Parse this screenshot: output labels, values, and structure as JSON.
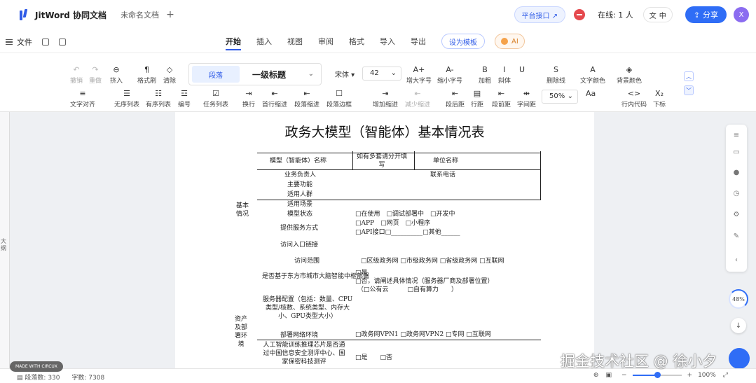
{
  "topbar": {
    "app_title": "JitWord 协同文档",
    "doc_tab": "未命名文档",
    "new_tab": "+",
    "platform_btn": "平台接口 ↗",
    "online": "在线: 1 人",
    "lang": "中",
    "share": "分享",
    "avatar": "X"
  },
  "menubar": {
    "file": "文件",
    "tabs": [
      "开始",
      "插入",
      "视图",
      "审阅",
      "格式",
      "导入",
      "导出"
    ],
    "set_template": "设为模板",
    "ai": "AI"
  },
  "toolbar": {
    "row1": [
      {
        "icon": "↶",
        "label": "撤销"
      },
      {
        "icon": "↷",
        "label": "重做"
      },
      {
        "icon": "⊖",
        "label": "挤入"
      },
      {
        "icon": "¶",
        "label": "格式刷"
      },
      {
        "icon": "◇",
        "label": "清除"
      },
      {
        "icon": "A+",
        "label": "增大字号"
      },
      {
        "icon": "A-",
        "label": "缩小字号"
      },
      {
        "icon": "B",
        "label": "加粗"
      },
      {
        "icon": "I",
        "label": "斜体"
      },
      {
        "icon": "U",
        "label": ""
      },
      {
        "icon": "S",
        "label": "删除线"
      },
      {
        "icon": "A",
        "label": "文字颜色"
      },
      {
        "icon": "◈",
        "label": "背景颜色"
      }
    ],
    "style_chip": "段落",
    "style_heading": "一级标题",
    "font": "宋体",
    "font_size": "42",
    "row2": [
      {
        "icon": "≡",
        "label": "文字对齐"
      },
      {
        "icon": "☰",
        "label": "无序列表"
      },
      {
        "icon": "☷",
        "label": "有序列表"
      },
      {
        "icon": "☲",
        "label": "编号"
      },
      {
        "icon": "☑",
        "label": "任务列表"
      },
      {
        "icon": "⇥",
        "label": "换行"
      },
      {
        "icon": "⇤",
        "label": "首行缩进"
      },
      {
        "icon": "⇤",
        "label": "段落缩进"
      },
      {
        "icon": "☐",
        "label": "段落边框"
      },
      {
        "icon": "⇥",
        "label": "增加缩进"
      },
      {
        "icon": "⇤",
        "label": "减少缩进"
      },
      {
        "icon": "⇤",
        "label": "段后距"
      },
      {
        "icon": "▤",
        "label": "行距"
      },
      {
        "icon": "⇤",
        "label": "段前距"
      },
      {
        "icon": "⇹",
        "label": "字间距"
      },
      {
        "icon": "Aa",
        "label": ""
      },
      {
        "icon": "<>",
        "label": "行内代码"
      },
      {
        "icon": "X₂",
        "label": "下标"
      }
    ],
    "zoom": "50%"
  },
  "document": {
    "gutter_label": "大纲",
    "title": "政务大模型（智能体）基本情况表",
    "rows": [
      "模型（智能体）名称",
      "如有多套请分开填写",
      "单位名称",
      "业务负责人",
      "联系电话",
      "主要功能",
      "适用人群",
      "基本情况",
      "适用场景",
      "模型状态",
      "□在使用　□调试部署中　□开发中",
      "提供服务方式",
      "□APP　□网页　□小程序",
      "□API接口□__________□其他______",
      "访问入口链接",
      "访问范围",
      "□区级政务网 □市级政务网 □省级政务网 □互联网",
      "是否基于东方市城市大脑智能中枢部署",
      "□是",
      "□否，请阐述具体情况（服务器厂商及部署位置）",
      "（□公有云　　　□自有算力　　）",
      "服务器配置（包括：数量、CPU类型/核数、系统类型、内存大小、GPU类型大小）",
      "资产及部署环境",
      "部署网络环境",
      "□政务网VPN1 □政务网VPN2 □专网 □互联网",
      "人工智能训练推理芯片是否通过中国信息安全测评中心、国家保密科技测评",
      "□是　　□否"
    ]
  },
  "sidebar": {
    "progress_pct": 48,
    "progress_label": "48%"
  },
  "statusbar": {
    "paragraphs_label": "段落数:",
    "paragraphs": "330",
    "chars_label": "字数:",
    "chars": "7308",
    "zoom": "100%",
    "zoom_fraction": 0.5
  },
  "overlay": {
    "made_with": "MADE WITH CIRCUX",
    "watermark": "掘金技术社区 @ 徐小夕"
  },
  "colors": {
    "accent": "#2f6df6",
    "brand": "#2f5be7",
    "ai_orange": "#f5a24a"
  }
}
